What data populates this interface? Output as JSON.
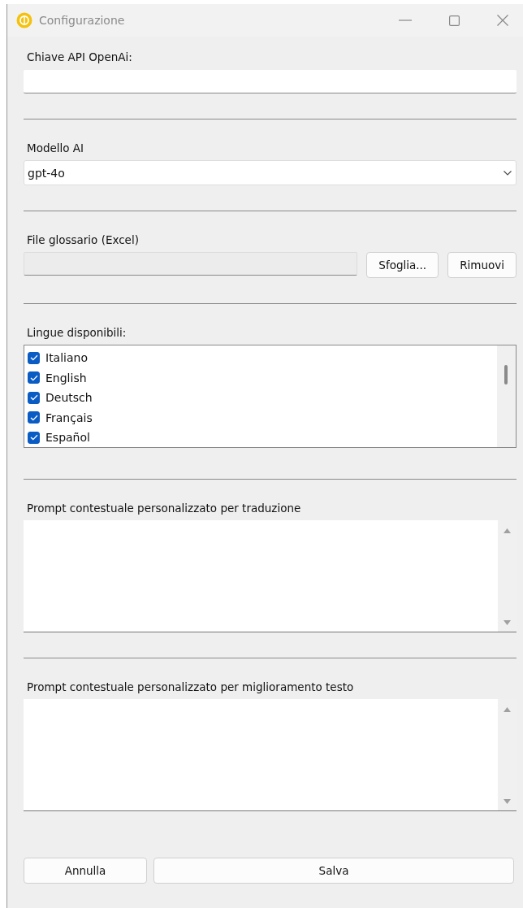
{
  "window": {
    "title": "Configurazione"
  },
  "api_key": {
    "label": "Chiave API OpenAi:"
  },
  "model": {
    "label": "Modello AI",
    "value": "gpt-4o"
  },
  "glossary": {
    "label": "File glossario (Excel)",
    "buttons": [
      "Sfoglia...",
      "Rimuovi"
    ]
  },
  "languages": {
    "label": "Lingue disponibili:",
    "items": [
      {
        "label": "Italiano",
        "checked": true
      },
      {
        "label": "English",
        "checked": true
      },
      {
        "label": "Deutsch",
        "checked": true
      },
      {
        "label": "Français",
        "checked": true
      },
      {
        "label": "Español",
        "checked": true
      }
    ]
  },
  "prompts": [
    {
      "label": "Prompt contestuale personalizzato per traduzione"
    },
    {
      "label": "Prompt contestuale personalizzato per miglioramento testo"
    }
  ],
  "buttons": [
    {
      "label": "Annulla",
      "kind": "cancel"
    },
    {
      "label": "Salva",
      "kind": "save"
    }
  ]
}
